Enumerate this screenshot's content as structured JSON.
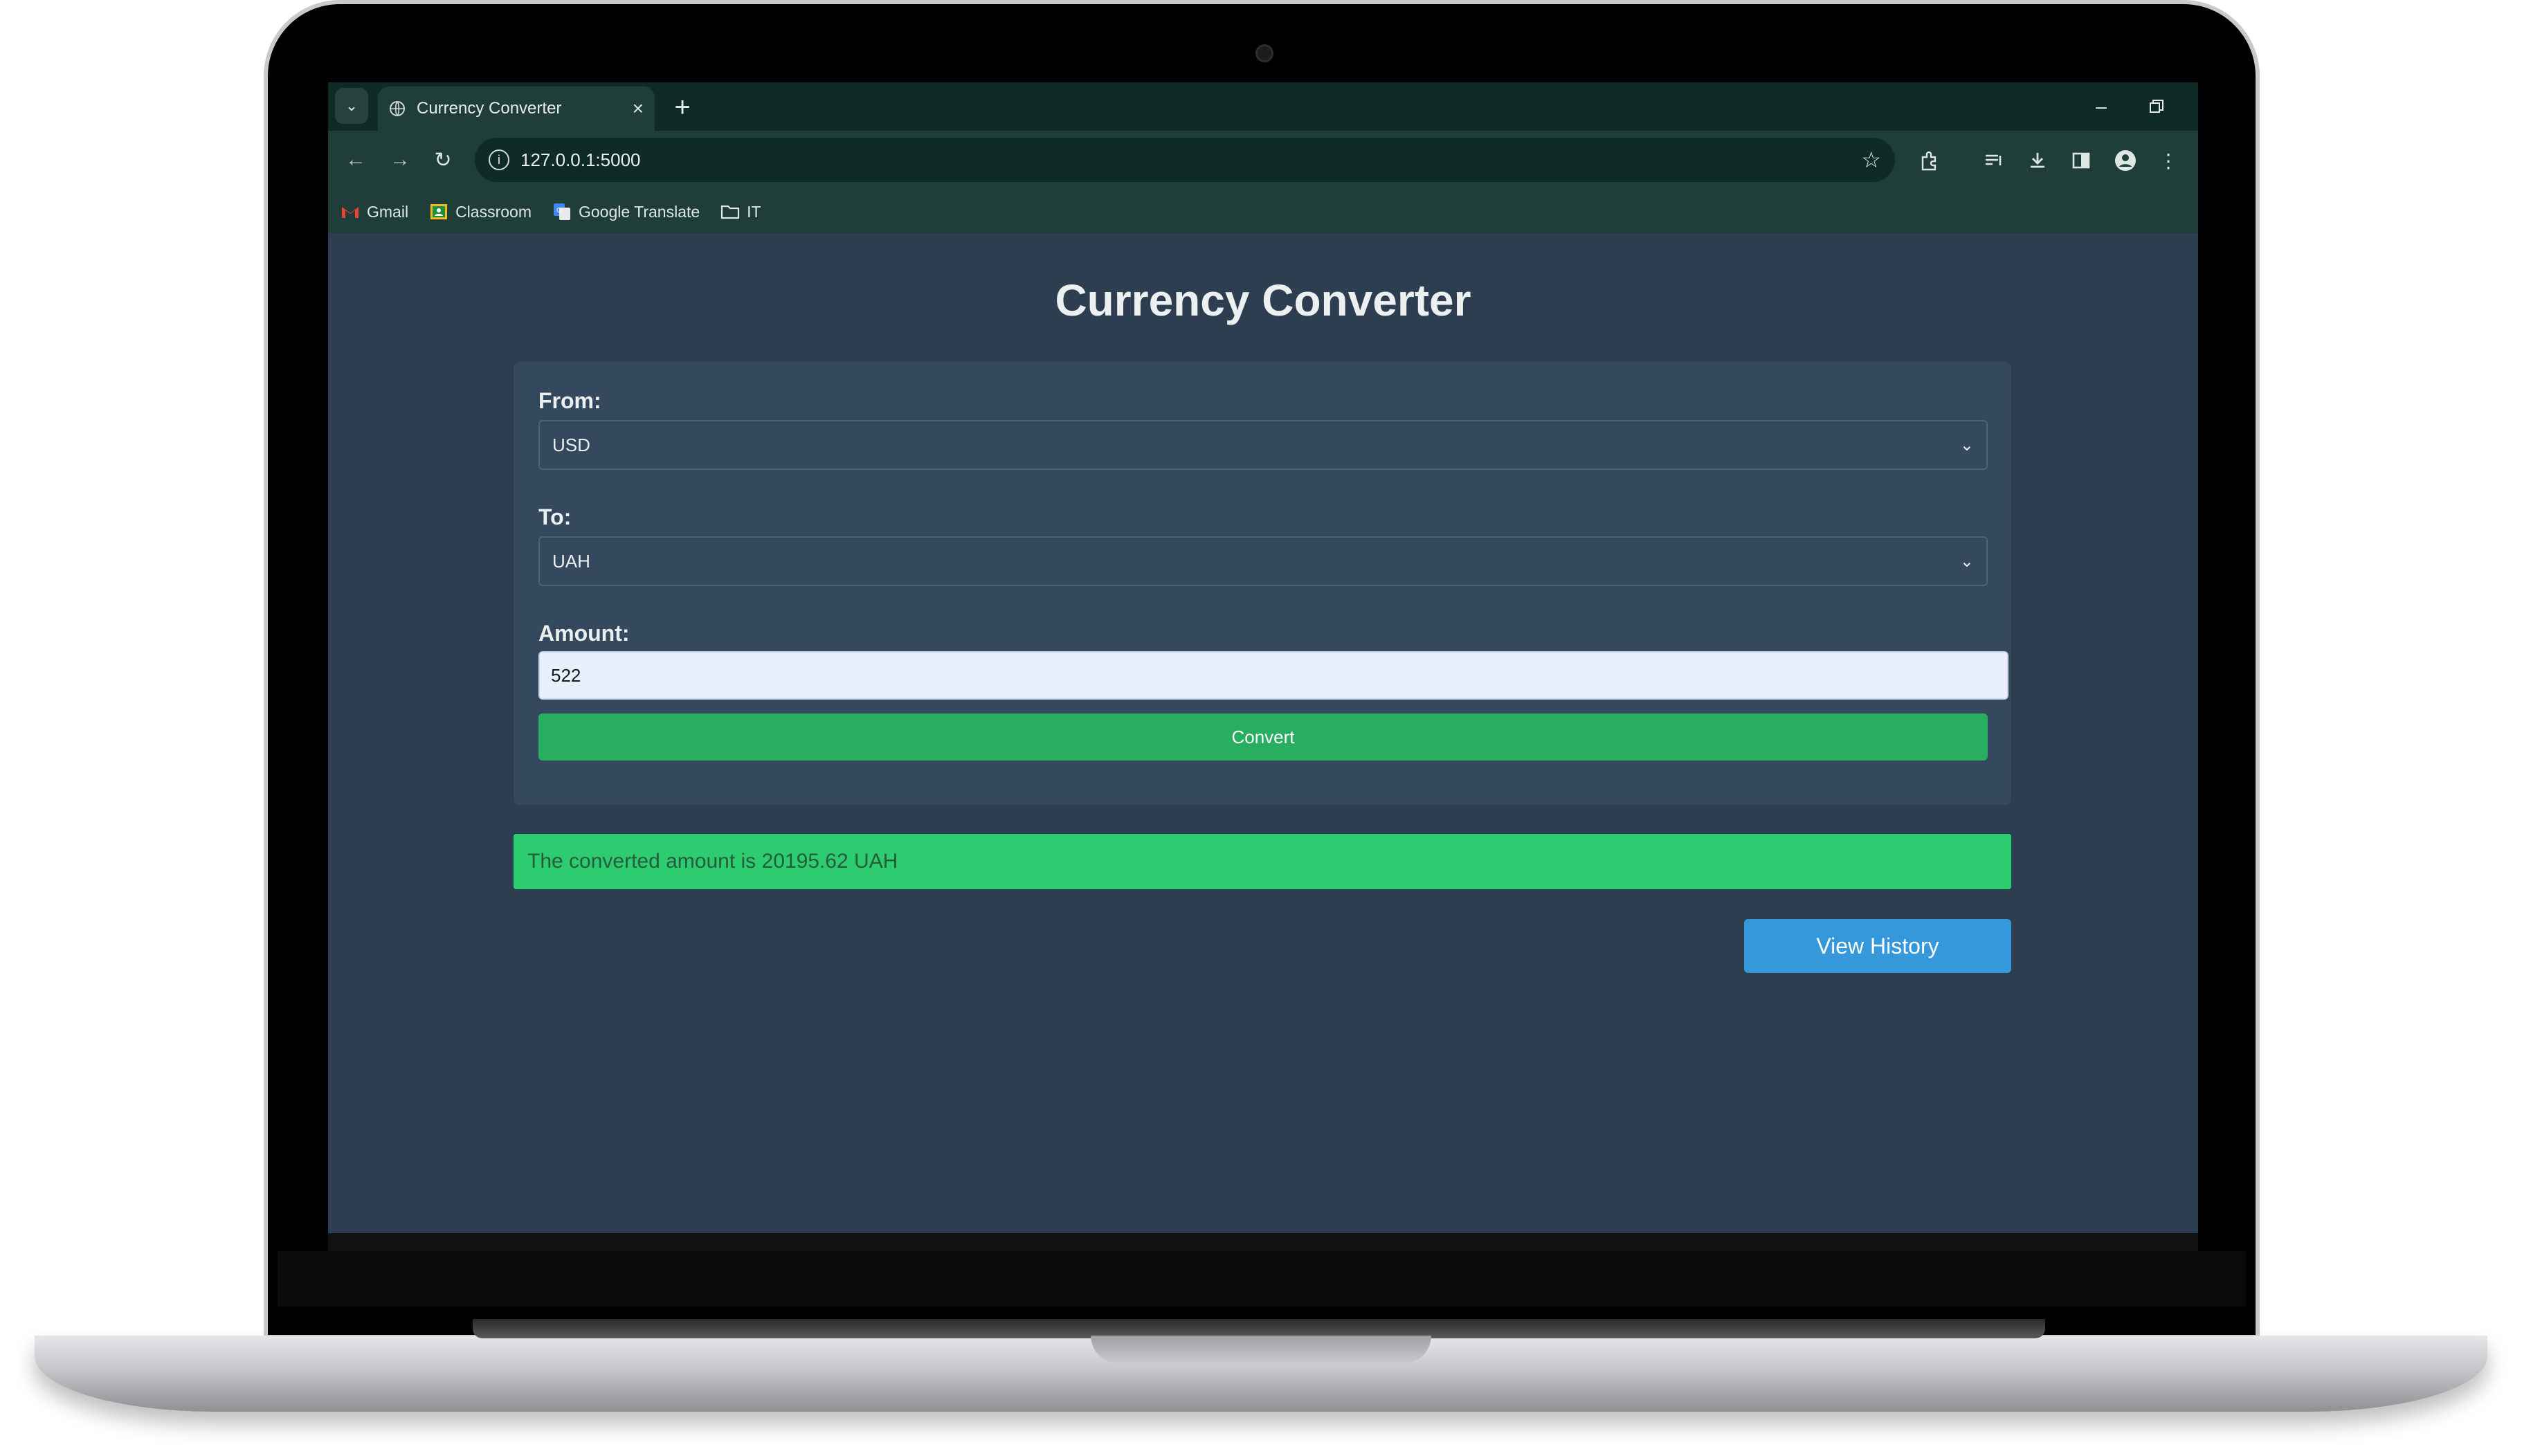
{
  "browser": {
    "tab_title": "Currency Converter",
    "new_tab_symbol": "+",
    "url": "127.0.0.1:5000",
    "bookmarks": [
      {
        "label": "Gmail",
        "icon": "gmail-icon"
      },
      {
        "label": "Classroom",
        "icon": "classroom-icon"
      },
      {
        "label": "Google Translate",
        "icon": "translate-icon"
      },
      {
        "label": "IT",
        "icon": "folder-icon"
      }
    ]
  },
  "page": {
    "title": "Currency Converter",
    "from_label": "From:",
    "from_value": "USD",
    "to_label": "To:",
    "to_value": "UAH",
    "amount_label": "Amount:",
    "amount_value": "522",
    "convert_label": "Convert",
    "result_text": "The converted amount is 20195.62 UAH",
    "history_label": "View History"
  },
  "colors": {
    "page_bg": "#2c3e50",
    "card_bg": "#34495e",
    "convert_button": "#27ae60",
    "result_bg": "#2ecc71",
    "history_button": "#3498db",
    "browser_chrome": "#1f3d39"
  }
}
